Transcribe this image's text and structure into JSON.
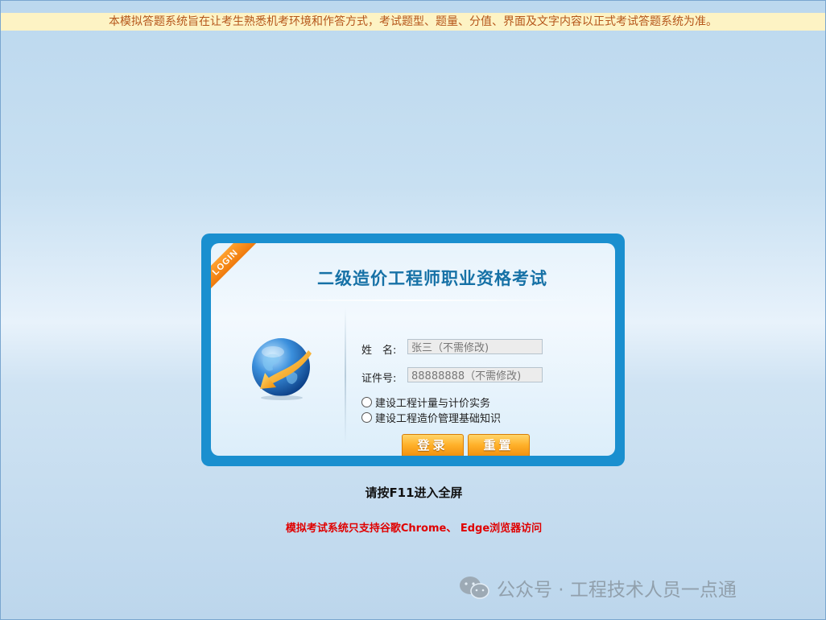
{
  "notice": "本模拟答题系统旨在让考生熟悉机考环境和作答方式，考试题型、题量、分值、界面及文字内容以正式考试答题系统为准。",
  "login": {
    "ribbon": "LOGIN",
    "title": "二级造价工程师职业资格考试",
    "name_label": "姓　名:",
    "name_value": "张三（不需修改)",
    "id_label": "证件号:",
    "id_value": "88888888（不需修改)",
    "subjects": [
      {
        "label": "建设工程计量与计价实务",
        "checked": false
      },
      {
        "label": "建设工程造价管理基础知识",
        "checked": false
      }
    ],
    "login_button": "登录",
    "reset_button": "重置"
  },
  "hint_f11": "请按F11进入全屏",
  "browser_note": "模拟考试系统只支持谷歌Chrome、 Edge浏览器访问",
  "watermark": "公众号 · 工程技术人员一点通",
  "colors": {
    "title": "#1671a6",
    "frame": "#1a8fcf",
    "button": "#ffb12a",
    "warning": "#e00000",
    "notice_bg": "#fdf3c4"
  }
}
